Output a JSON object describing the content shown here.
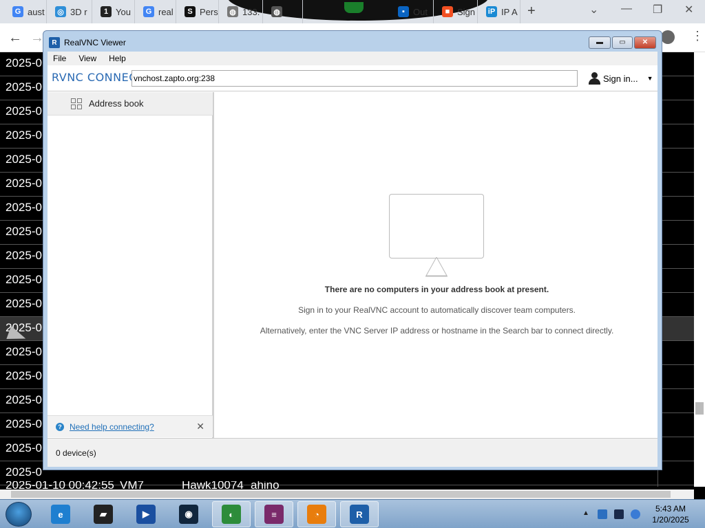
{
  "browser": {
    "tabs": [
      {
        "label": "aust",
        "favicon": "google-icon",
        "color": "#4285f4",
        "glyph": "G"
      },
      {
        "label": "3D r",
        "favicon": "globe-blue-icon",
        "color": "#2f8fd8",
        "glyph": "◎"
      },
      {
        "label": "You",
        "favicon": "number-one-icon",
        "color": "#222222",
        "glyph": "1"
      },
      {
        "label": "real",
        "favicon": "google-icon",
        "color": "#4285f4",
        "glyph": "G"
      },
      {
        "label": "Pers",
        "favicon": "s-icon",
        "color": "#111111",
        "glyph": "S"
      },
      {
        "label": "133.",
        "favicon": "globe-icon",
        "color": "#777777",
        "glyph": "◍"
      },
      {
        "label": "",
        "favicon": "globe-icon",
        "color": "#555555",
        "glyph": "◍"
      },
      {
        "label": "Out",
        "favicon": "outlook-icon",
        "color": "#0a64c2",
        "glyph": "▪"
      },
      {
        "label": "Sign",
        "favicon": "microsoft-icon",
        "color": "#f25022",
        "glyph": "■"
      },
      {
        "label": "IP A",
        "favicon": "ip-icon",
        "color": "#1a8ad4",
        "glyph": "iP"
      }
    ],
    "new_tab": "+",
    "controls": {
      "dropdown": "⌄",
      "minimize": "—",
      "restore": "❐",
      "close": "✕"
    },
    "nav": {
      "back": "←",
      "forward": "→",
      "menu": "⋮"
    }
  },
  "background_table": {
    "rows": [
      "2025-0",
      "2025-0",
      "2025-0",
      "2025-0",
      "2025-0",
      "2025-0",
      "2025-0",
      "2025-0",
      "2025-0",
      "2025-0",
      "2025-0",
      "2025-0",
      "2025-0",
      "2025-0",
      "2025-0",
      "2025-0",
      "2025-0",
      "2025-0"
    ],
    "highlight_row": 11,
    "bottom_row": [
      "2025-01-10 00:42:55",
      "VM7",
      "Hawk10074",
      "ahino"
    ]
  },
  "vnc": {
    "title": "RealVNC Viewer",
    "logo_glyph": "R",
    "buttons": {
      "minimize": "▬",
      "maximize": "▭",
      "close": "✕"
    },
    "menu": [
      "File",
      "View",
      "Help"
    ],
    "brand": "RVNC CONNECT",
    "host_value": "vnchost.zapto.org:238",
    "signin_label": "Sign in...",
    "signin_caret": "▼",
    "sidebar": {
      "address_book": "Address book",
      "help_link": "Need help connecting?",
      "help_close": "✕",
      "help_glyph": "?"
    },
    "empty_state": {
      "title": "There are no computers in your address book at present.",
      "msg1": "Sign in to your RealVNC account to automatically discover team computers.",
      "msg2": "Alternatively, enter the VNC Server IP address or hostname in the Search bar to connect directly."
    },
    "status": "0 device(s)"
  },
  "taskbar": {
    "apps": [
      {
        "name": "internet-explorer",
        "glyph": "e",
        "color": "#1e7fd0"
      },
      {
        "name": "black-box-app",
        "glyph": "▰",
        "color": "#222222"
      },
      {
        "name": "media-player",
        "glyph": "▶",
        "color": "#1a4fa0"
      },
      {
        "name": "dark-globe",
        "glyph": "◉",
        "color": "#10263d"
      },
      {
        "name": "earth-app",
        "glyph": "◐",
        "color": "#2d8c3a"
      },
      {
        "name": "winrar",
        "glyph": "≡",
        "color": "#7a2a6a"
      },
      {
        "name": "blender",
        "glyph": "◔",
        "color": "#e87d0d"
      },
      {
        "name": "realvnc",
        "glyph": "R",
        "color": "#1e5fa8"
      }
    ],
    "tray_arrow": "▲",
    "time": "5:43 AM",
    "date": "1/20/2025"
  }
}
